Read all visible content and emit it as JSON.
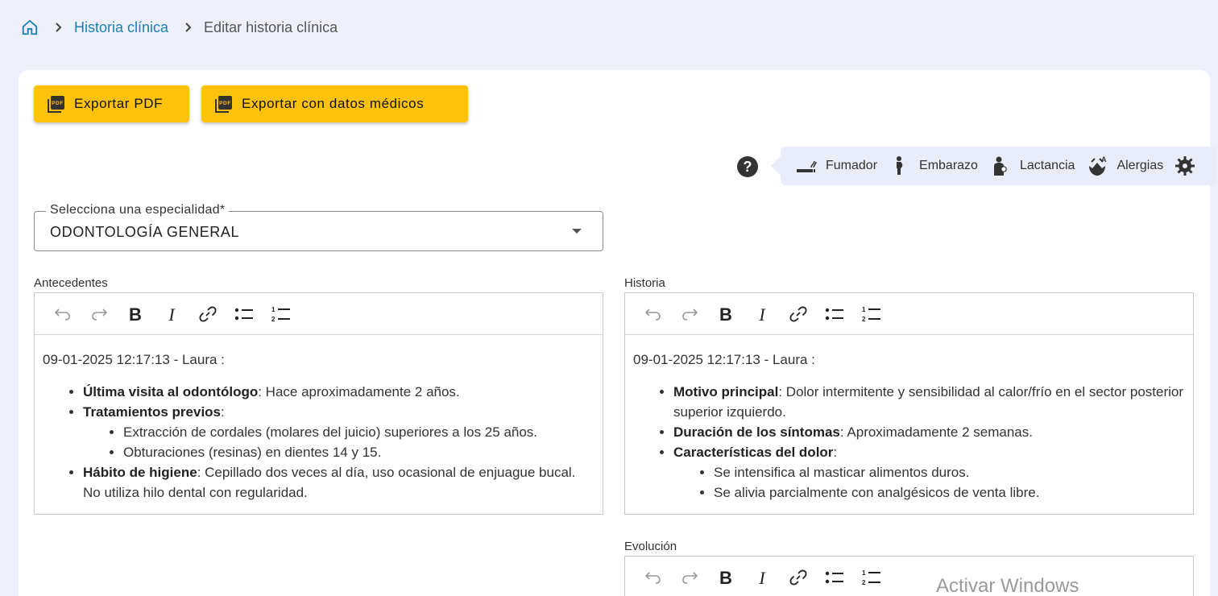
{
  "breadcrumb": {
    "home_icon": "home-icon",
    "link": "Historia clínica",
    "current": "Editar historia clínica"
  },
  "actions": {
    "export_pdf": "Exportar PDF",
    "export_medical": "Exportar con datos médicos",
    "icon": "pdf-icon",
    "accent_color": "#fdc20b"
  },
  "flags": {
    "help_icon": "help-circle-icon",
    "items": [
      {
        "label": "Fumador",
        "icon": "smoking-icon"
      },
      {
        "label": "Embarazo",
        "icon": "pregnant-icon"
      },
      {
        "label": "Lactancia",
        "icon": "breastfeeding-icon"
      },
      {
        "label": "Alergias",
        "icon": "allergy-icon"
      }
    ],
    "settings_icon": "gear-icon"
  },
  "specialty": {
    "label": "Selecciona una especialidad*",
    "value": "ODONTOLOGÍA GENERAL"
  },
  "editors": {
    "antecedentes": {
      "label": "Antecedentes",
      "stamp": "09-01-2025 12:17:13 - Laura :",
      "items": [
        {
          "bold": "Última visita al odontólogo",
          "text": ": Hace aproximadamente 2 años."
        },
        {
          "bold": "Tratamientos previos",
          "text": ":",
          "sub": [
            "Extracción de cordales (molares del juicio) superiores a los 25 años.",
            "Obturaciones (resinas) en dientes 14 y 15."
          ]
        },
        {
          "bold": "Hábito de higiene",
          "text": ": Cepillado dos veces al día, uso ocasional de enjuague bucal. No utiliza hilo dental con regularidad."
        }
      ]
    },
    "historia": {
      "label": "Historia",
      "stamp": "09-01-2025 12:17:13 - Laura :",
      "items": [
        {
          "bold": "Motivo principal",
          "text": ": Dolor intermitente y sensibilidad al calor/frío en el sector posterior superior izquierdo."
        },
        {
          "bold": "Duración de los síntomas",
          "text": ": Aproximadamente 2 semanas."
        },
        {
          "bold": "Características del dolor",
          "text": ":",
          "sub": [
            "Se intensifica al masticar alimentos duros.",
            "Se alivia parcialmente con analgésicos de venta libre."
          ]
        }
      ]
    },
    "evolucion": {
      "label": "Evolución"
    },
    "toolbar_icons": [
      "undo-icon",
      "redo-icon",
      "bold-icon",
      "italic-icon",
      "link-icon",
      "bullet-list-icon",
      "numbered-list-icon"
    ]
  },
  "watermark": "Activar Windows"
}
